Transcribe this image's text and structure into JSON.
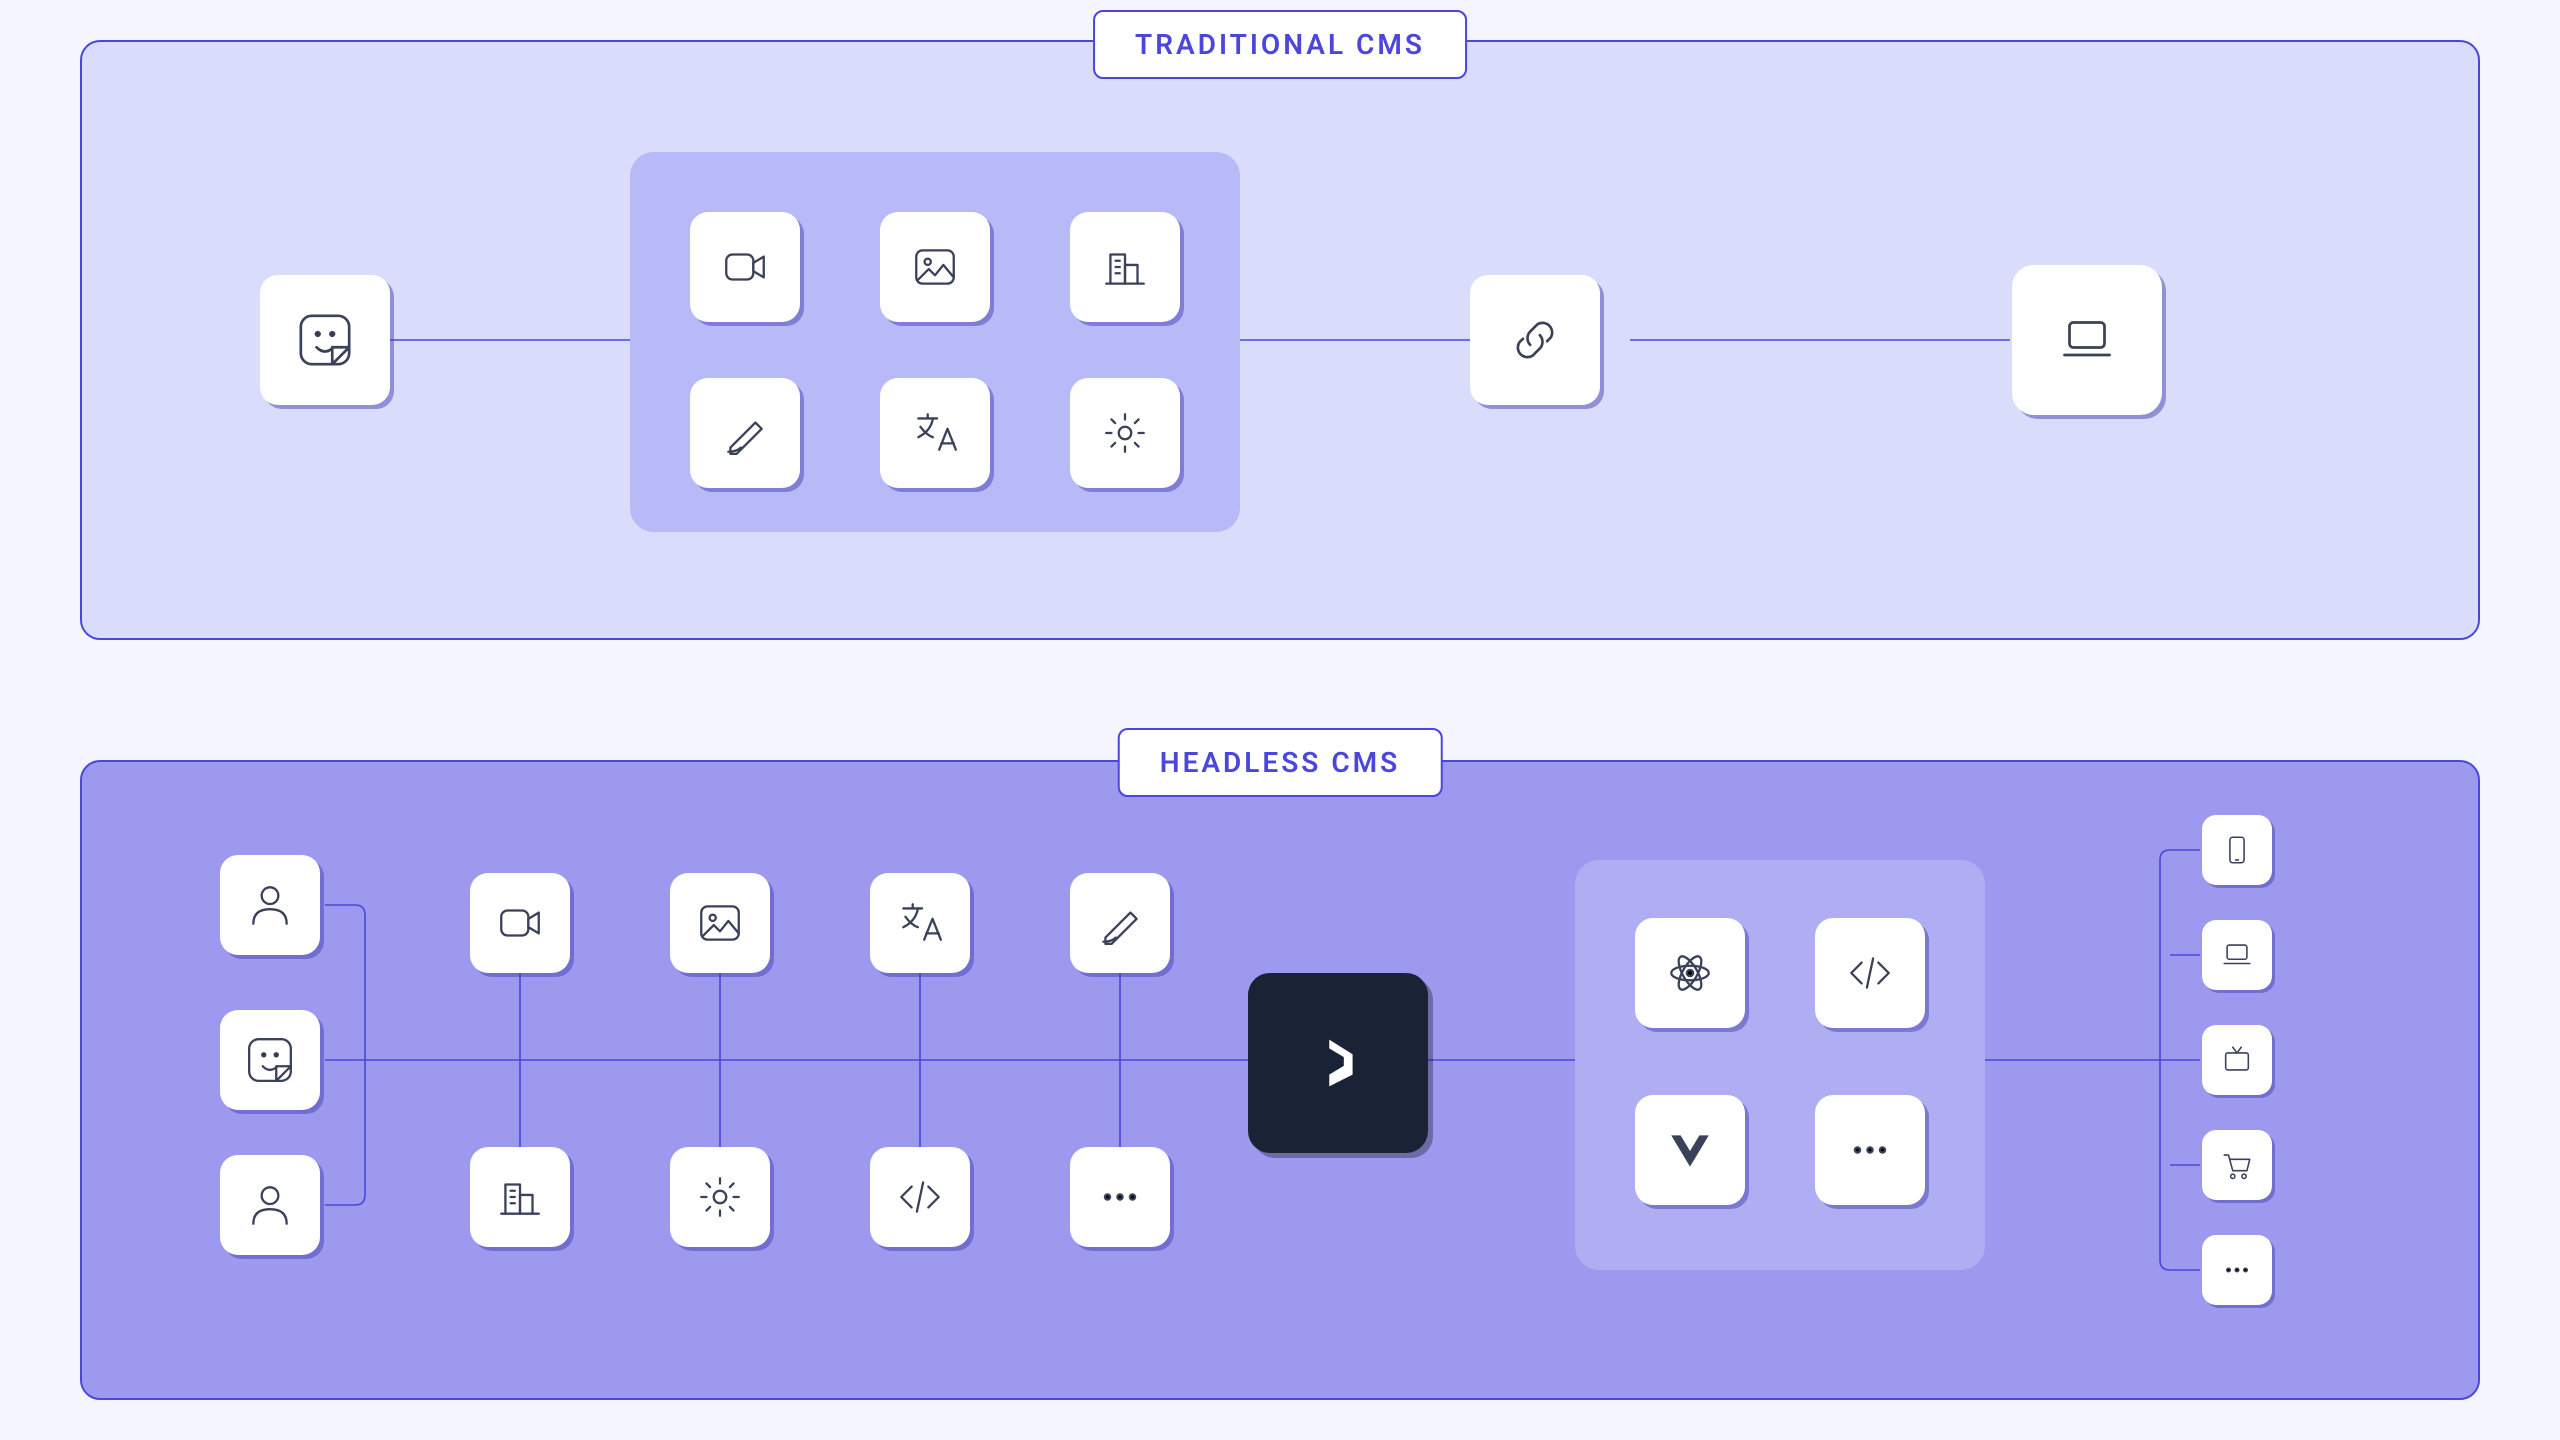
{
  "diagram": {
    "traditional": {
      "label": "TRADITIONAL CMS",
      "nodes": {
        "user": "sticker-smile-icon",
        "content_panel": [
          "video-icon",
          "image-icon",
          "building-icon",
          "pen-icon",
          "translate-icon",
          "gear-icon"
        ],
        "link": "link-icon",
        "output": "laptop-icon"
      }
    },
    "headless": {
      "label": "HEADLESS CMS",
      "users": [
        "user-icon",
        "sticker-smile-icon",
        "user-icon"
      ],
      "content_row_top": [
        "video-icon",
        "image-icon",
        "translate-icon",
        "pen-icon"
      ],
      "content_row_bottom": [
        "building-icon",
        "gear-icon",
        "code-icon",
        "more-icon"
      ],
      "hub": "directus-logo-icon",
      "frameworks": [
        "react-icon",
        "code-icon",
        "vue-icon",
        "more-icon"
      ],
      "outputs": [
        "smartphone-icon",
        "laptop-icon",
        "tv-icon",
        "cart-icon",
        "more-icon"
      ]
    }
  },
  "colors": {
    "bg": "#f5f5ff",
    "panel_light": "#dadcfc",
    "panel_dark": "#9c99ef",
    "accent": "#4b46dc",
    "tile": "#ffffff",
    "hub": "#1a2236",
    "icon": "#3a4158"
  }
}
